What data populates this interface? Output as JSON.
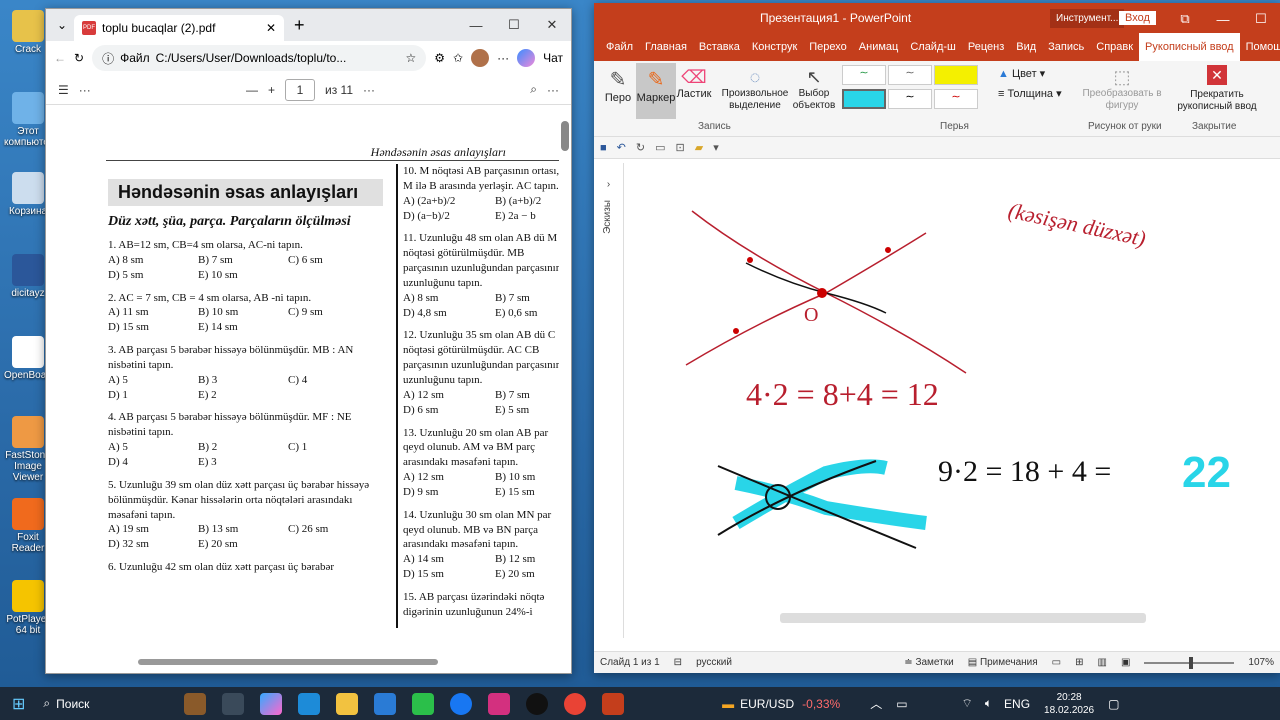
{
  "desktop": {
    "icons": [
      "Crack",
      "Этот компьютер",
      "Корзина",
      "dicitayz",
      "OpenBoard",
      "FastStone Image Viewer",
      "Foxit Reader",
      "PotPlayer 64 bit"
    ]
  },
  "edge": {
    "tab_title": "toplu bucaqlar (2).pdf",
    "address_prefix": "Файл",
    "address": "C:/Users/User/Downloads/toplu/to...",
    "chat_label": "Чат",
    "page_current": "1",
    "page_total": "из 11"
  },
  "pdf": {
    "header": "Həndəsənin əsas anlayışları",
    "title": "Həndəsənin əsas anlayışları",
    "subtitle": "Düz xətt, şüa, parça. Parçaların ölçülməsi",
    "left_questions": [
      {
        "text": "1. AB=12 sm, CB=4 sm olarsa, AC-ni tapın.",
        "opts": [
          "A) 8 sm",
          "B) 7 sm",
          "C) 6 sm",
          "D) 5 sm",
          "E) 10 sm"
        ]
      },
      {
        "text": "2. AC = 7 sm, CB = 4 sm olarsa, AB -ni tapın.",
        "opts": [
          "A) 11 sm",
          "B) 10 sm",
          "C) 9 sm",
          "D) 15 sm",
          "E) 14 sm"
        ]
      },
      {
        "text": "3. AB parçası 5 bərabər hissəyə bölünmüşdür. MB : AN nisbətini tapın.",
        "opts": [
          "A) 5",
          "B) 3",
          "C) 4",
          "D) 1",
          "E) 2"
        ]
      },
      {
        "text": "4. AB parçası 5 bərabər hissəyə bölünmüşdür. MF : NE nisbətini tapın.",
        "opts": [
          "A) 5",
          "B) 2",
          "C) 1",
          "D) 4",
          "E) 3"
        ]
      },
      {
        "text": "5. Uzunluğu 39 sm olan düz xətt parçası üç bərabər hissəyə bölünmüşdür. Kənar hissələrin orta nöqtələri arasındakı məsafəni tapın.",
        "opts": [
          "A) 19 sm",
          "B) 13 sm",
          "C) 26 sm",
          "D) 32 sm",
          "E) 20 sm"
        ]
      },
      {
        "text": "6. Uzunluğu 42 sm olan düz xətt parçası üç bərabər",
        "opts": []
      }
    ],
    "right_questions": [
      {
        "text": "10. M nöqtəsi AB parçasının ortası, M ilə B arasında yerləşir. AC tapın.",
        "opts": [
          "A) (2a+b)/2",
          "B) (a+b)/2",
          "D) (a−b)/2",
          "E) 2a − b"
        ]
      },
      {
        "text": "11. Uzunluğu 48 sm olan AB dü M nöqtəsi götürülmüşdür. MB parçasının uzunluğundan parçasının uzunluğunu tapın.",
        "opts": [
          "A) 8 sm",
          "B) 7 sm",
          "D) 4,8 sm",
          "E) 0,6 sm"
        ]
      },
      {
        "text": "12. Uzunluğu 35 sm olan AB dü C nöqtəsi götürülmüşdür. AC CB parçasının uzunluğundan parçasının uzunluğunu tapın.",
        "opts": [
          "A) 12 sm",
          "B) 7 sm",
          "D) 6 sm",
          "E) 5 sm"
        ]
      },
      {
        "text": "13. Uzunluğu 20 sm olan AB par qeyd olunub. AM və BM parç arasındakı məsafəni tapın.",
        "opts": [
          "A) 12 sm",
          "B) 10 sm",
          "D) 9 sm",
          "E) 15 sm"
        ]
      },
      {
        "text": "14. Uzunluğu 30 sm olan MN par qeyd olunub. MB və BN parça arasındakı məsafəni tapın.",
        "opts": [
          "A) 14 sm",
          "B) 12 sm",
          "D) 15 sm",
          "E) 20 sm"
        ]
      },
      {
        "text": "15. AB parçası üzərindəki nöqtə digərinin uzunluğunun 24%-i",
        "opts": []
      }
    ]
  },
  "ppt": {
    "title": "Презентация1 - PowerPoint",
    "context_label": "Инструмент...",
    "signin_label": "Вход",
    "tabs": [
      "Файл",
      "Главная",
      "Вставка",
      "Конструк",
      "Перехо",
      "Анимац",
      "Слайд-ш",
      "Реценз",
      "Вид",
      "Запись",
      "Справк"
    ],
    "active_tab": "Рукописный ввод",
    "help_label": "Помощн",
    "share_label": "Поделит",
    "ribbon": {
      "pen": "Перо",
      "marker": "Маркер",
      "eraser": "Ластик",
      "lasso": "Произвольное выделение",
      "select": "Выбор объектов",
      "group_write": "Запись",
      "color": "Цвет",
      "thickness": "Толщина",
      "group_pens": "Перья",
      "convert": "Преобразовать в фигуру",
      "group_convert": "Рисунок от руки",
      "stop": "Прекратить рукописный ввод",
      "group_close": "Закрытие"
    },
    "thumbs_label": "Эскизы",
    "status": {
      "slide": "Слайд 1 из 1",
      "lang": "русский",
      "notes": "Заметки",
      "comments": "Примечания",
      "zoom": "107%"
    },
    "ink_text": {
      "top_right": "(kəsişən düzxət)",
      "eq1": "4·2 = 8+4 = 12",
      "eq2": "9·2 = 18 + 4 =",
      "answer": "22",
      "label_o": "O"
    }
  },
  "taskbar": {
    "search": "Поиск",
    "currency": "EUR/USD",
    "change": "-0,33%",
    "lang": "ENG",
    "time": "20:28",
    "date": "18.02.2026"
  }
}
